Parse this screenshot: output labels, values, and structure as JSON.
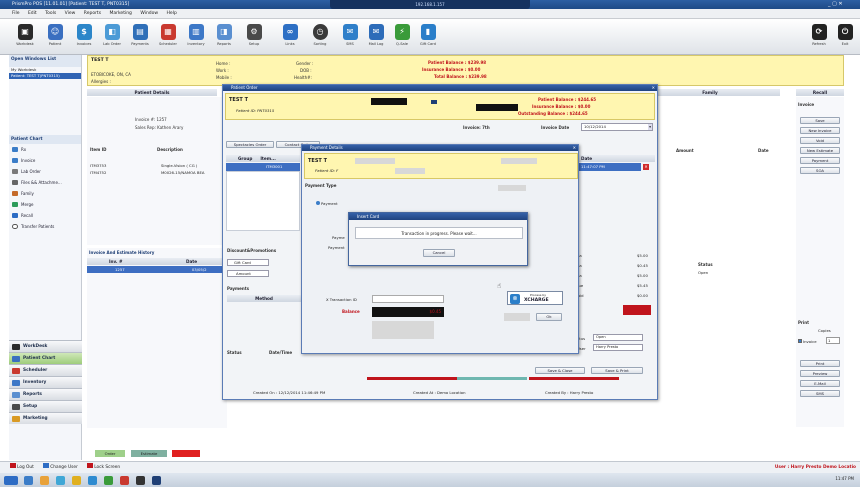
{
  "app": {
    "title": "PrismPro POS  [11.01.01]  [Patient: TEST T, PNT0315]",
    "window_caption": "192.168.1.157"
  },
  "menu": [
    "File",
    "Edit",
    "Tools",
    "View",
    "Reports",
    "Marketing",
    "Window",
    "Help"
  ],
  "toolbar": {
    "items": [
      "Workdesk",
      "Patient",
      "Invoices",
      "Lab Order",
      "Payments",
      "Scheduler",
      "Inventory",
      "Reports",
      "Setup",
      "Links",
      "Sorting",
      "SMS",
      "Mail Log",
      "Q-Sale",
      "Gift Card"
    ],
    "right_items": [
      "Refresh",
      "Exit"
    ]
  },
  "left_panel": {
    "header": "Open Windows List",
    "items": [
      "My Workdesk",
      "Patient: TEST T(PNT0315)"
    ],
    "chart_header": "Patient Chart",
    "chart_items": [
      "Rx",
      "Invoice",
      "Lab Order",
      "Files && Attachme...",
      "Family",
      "Merge",
      "Recall",
      "Transfer Patients"
    ],
    "nav": [
      "WorkDesk",
      "Patient Chart",
      "Scheduler",
      "Inventory",
      "Reports",
      "Setup",
      "Marketing"
    ]
  },
  "patient_header": {
    "name": "TEST T",
    "address": "ETOBICOKE, ON, CA",
    "allergies": "Allergies :",
    "home_label": "Home :",
    "work_label": "Work :",
    "mobile_label": "Mobile :",
    "gender_label": "Gender :",
    "dob_label": "DOB :",
    "health_label": "Health#:",
    "patient_balance": "Patient Balance : $239.98",
    "insurance_balance": "Insurance Balance : $0.00",
    "total_balance": "Total Balance : $239.98"
  },
  "tabs": {
    "patient_details": "Patient Details",
    "family": "Family",
    "recall": "Recall"
  },
  "invoice_info": {
    "invoice_no": "Invoice #: 1257",
    "sales_rep": "Sales Rep: Kathen Arary",
    "item_header": "Item ID",
    "desc_header": "Description",
    "rows": [
      {
        "id": "ITM3753",
        "desc": "Single-Vision ( CG )"
      },
      {
        "id": "ITM4752",
        "desc": "M0026-15/NAMOA BEA"
      }
    ]
  },
  "history": {
    "title": "Invoice And Estimate History",
    "col_inv": "Inv. #",
    "col_date": "Date",
    "row_inv": "1257",
    "row_date": "03/05/2"
  },
  "right_panel": {
    "invoice_hdr": "Invoice",
    "buttons": [
      "Save",
      "New Invoice",
      "Void",
      "New Estimate",
      "Payment",
      "SOA"
    ],
    "print_hdr": "Print",
    "print_buttons": [
      "Print",
      "Preview",
      "E-Mail",
      "SMS"
    ],
    "copies_label": "Copies",
    "invoice_chk": "Invoice",
    "copies_value": "1"
  },
  "mid_cols": {
    "amount": "Amount",
    "date": "Date",
    "status": "Status",
    "status_val": "Open"
  },
  "order_dialog": {
    "title": "Patient Order",
    "patient": "TEST T",
    "patient_id": "Patient ID: PNT0315",
    "patient_balance": "Patient Balance : $244.65",
    "insurance_balance": "Insurance Balance : $0.00",
    "outstanding_balance": "Outstanding Balance : $244.65",
    "invoice_label": "Invoice: 7th",
    "invoice_date_label": "Invoice Date",
    "invoice_date": "10/12/2014",
    "tab1": "Spectacles Order",
    "tab2": "Contact Order",
    "group_hdr": "Group",
    "item_hdr": "Item...",
    "row_item": "ITM3001",
    "disc_title": "Discount&Promotions",
    "gift_card": "Gift Card",
    "amount_label": "Amount",
    "payments_title": "Payments",
    "method_hdr": "Method",
    "status_hdr": "Status",
    "datetime_hdr": "Date/Time",
    "user_hdr": "User",
    "created_on": "Created On : 12/12/2014 11:46:49 PM",
    "created_at": "Created At : Demo Location",
    "created_by": "Created By : Harry Presto",
    "date_hdr": "Date",
    "row_date": "11:47:07 PM",
    "amounts": [
      "$5.00",
      "$0.45",
      "$5.00",
      "$5.45",
      "$0.00"
    ],
    "amount_labels": [
      "Sa",
      "Sa",
      "Sa",
      "al Due",
      "al Paid"
    ],
    "status_label": "Status",
    "status_value": "Open",
    "user_label": "User",
    "user_value": "Harry Presto",
    "save_close": "Save & Close",
    "save_print": "Save & Print"
  },
  "payment_dialog": {
    "title": "Payment Details",
    "patient": "TEST T",
    "patient_id": "Patient ID: F",
    "payment_type": "Payment Type",
    "payment_radio": "Payment",
    "paym_label": "Payme",
    "payment_label": "Payment",
    "txn_label": "X Transaction ID",
    "balance_label": "Balance",
    "balance_value": "$0.45",
    "ok": "Ok",
    "process_by": "Process by",
    "xcharge": "XCHARGE"
  },
  "insert_card": {
    "title": "Insert Card",
    "message": "Transaction in progress.  Please wait...",
    "cancel": "Cancel"
  },
  "statusbar": {
    "logout": "Log Out",
    "change_user": "Change User",
    "lock": "Lock Screen",
    "right": "User : Harry Presto    Demo Locatio"
  },
  "legend": {
    "order": "Order",
    "estimate": "Estimate"
  },
  "clock": "11:47 PM"
}
